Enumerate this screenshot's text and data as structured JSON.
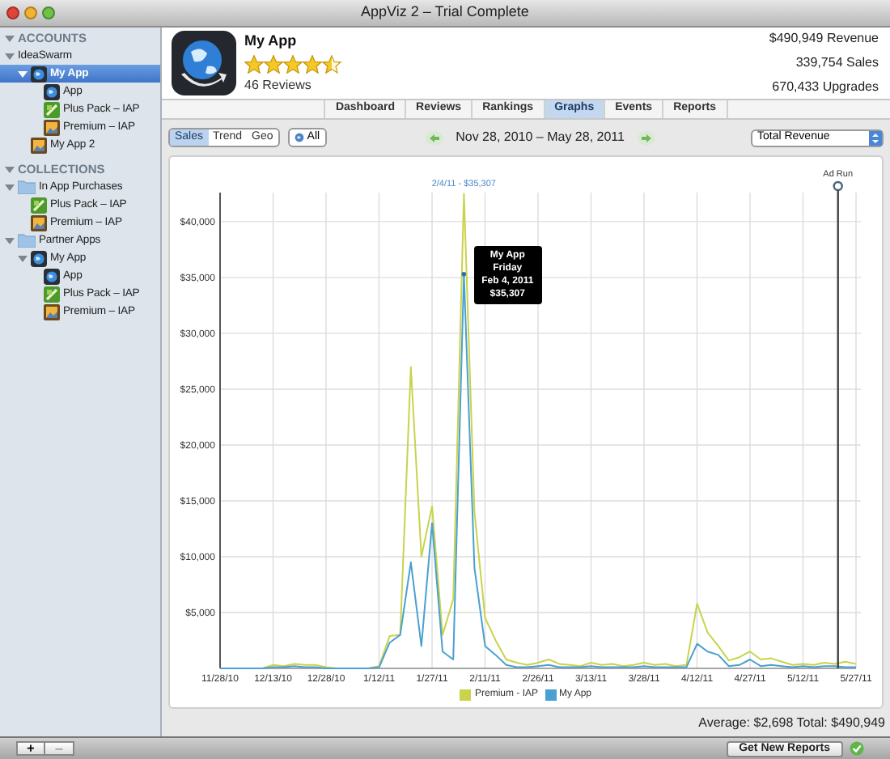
{
  "window": {
    "title": "AppViz 2 – Trial Complete"
  },
  "sidebar": {
    "sections": [
      {
        "title": "ACCOUNTS",
        "expanded": true,
        "items": [
          {
            "label": "IdeaSwarm",
            "selected": false,
            "expanded": true,
            "children": [
              {
                "label": "My App",
                "kind": "app",
                "selected": true,
                "expanded": true,
                "children": [
                  {
                    "label": "App",
                    "kind": "app",
                    "selected": false
                  },
                  {
                    "label": "Plus Pack – IAP",
                    "kind": "pack",
                    "selected": false
                  },
                  {
                    "label": "Premium – IAP",
                    "kind": "premium",
                    "selected": false
                  }
                ]
              },
              {
                "label": "My App 2",
                "kind": "premium",
                "selected": false
              }
            ]
          }
        ]
      },
      {
        "title": "COLLECTIONS",
        "expanded": true,
        "items": [
          {
            "label": "In App Purchases",
            "kind": "folder",
            "selected": false,
            "expanded": true,
            "children": [
              {
                "label": "Plus Pack – IAP",
                "kind": "pack",
                "selected": false
              },
              {
                "label": "Premium – IAP",
                "kind": "premium",
                "selected": false
              }
            ]
          },
          {
            "label": "Partner Apps",
            "kind": "folder",
            "selected": false,
            "expanded": true,
            "children": [
              {
                "label": "My App",
                "kind": "app",
                "selected": false,
                "expanded": true,
                "children": [
                  {
                    "label": "App",
                    "kind": "app",
                    "selected": false
                  },
                  {
                    "label": "Plus Pack – IAP",
                    "kind": "pack",
                    "selected": false
                  },
                  {
                    "label": "Premium – IAP",
                    "kind": "premium",
                    "selected": false
                  }
                ]
              }
            ]
          }
        ]
      }
    ]
  },
  "header": {
    "name": "My App",
    "stars": 4.5,
    "reviews": "46 Reviews",
    "stats": [
      "$490,949 Revenue",
      "339,754 Sales",
      "670,433 Upgrades"
    ]
  },
  "tabs": [
    {
      "label": "Dashboard",
      "selected": false
    },
    {
      "label": "Reviews",
      "selected": false
    },
    {
      "label": "Rankings",
      "selected": false
    },
    {
      "label": "Graphs",
      "selected": true
    },
    {
      "label": "Events",
      "selected": false
    },
    {
      "label": "Reports",
      "selected": false
    }
  ],
  "toolbar": {
    "modes": [
      {
        "label": "Sales",
        "selected": true
      },
      {
        "label": "Trend",
        "selected": false
      },
      {
        "label": "Geo",
        "selected": false
      }
    ],
    "filter": "All",
    "date_range": "Nov 28, 2010 – May 28, 2011",
    "metric": "Total Revenue"
  },
  "chart": {
    "tooltip": {
      "lines": [
        "My App",
        "Friday",
        "Feb 4, 2011",
        "$35,307"
      ]
    },
    "event_marker": {
      "label": "Ad Run"
    },
    "chart_data": {
      "type": "line",
      "categories": [
        "11/28/10",
        null,
        null,
        null,
        null,
        "12/13/10",
        null,
        null,
        null,
        null,
        "12/28/10",
        null,
        null,
        null,
        null,
        "1/12/11",
        null,
        null,
        null,
        null,
        "1/27/11",
        null,
        null,
        null,
        null,
        "2/11/11",
        null,
        null,
        null,
        null,
        "2/26/11",
        null,
        null,
        null,
        null,
        "3/13/11",
        null,
        null,
        null,
        null,
        "3/28/11",
        null,
        null,
        null,
        null,
        "4/12/11",
        null,
        null,
        null,
        null,
        "4/27/11",
        null,
        null,
        null,
        null,
        "5/12/11",
        null,
        null,
        null,
        null,
        "5/27/11"
      ],
      "series": [
        {
          "name": "Premium - IAP",
          "color": "#c9d34c",
          "values": [
            null,
            null,
            null,
            0,
            0,
            300,
            200,
            400,
            300,
            300,
            100,
            0,
            0,
            0,
            0,
            200,
            2900,
            3000,
            27000,
            10000,
            14500,
            3000,
            6200,
            42500,
            14000,
            4500,
            2500,
            800,
            500,
            300,
            500,
            800,
            400,
            300,
            200,
            500,
            300,
            400,
            200,
            300,
            500,
            300,
            400,
            200,
            300,
            5800,
            3200,
            2000,
            700,
            1000,
            1500,
            800,
            900,
            600,
            300,
            400,
            300,
            500,
            400,
            600,
            400
          ]
        },
        {
          "name": "My App",
          "color": "#4aa0d0",
          "values": [
            0,
            0,
            0,
            0,
            0,
            100,
            100,
            200,
            100,
            100,
            0,
            0,
            0,
            0,
            0,
            100,
            2300,
            3000,
            9500,
            2000,
            13000,
            1500,
            800,
            35300,
            9000,
            2000,
            1200,
            300,
            100,
            100,
            200,
            300,
            100,
            100,
            100,
            200,
            100,
            100,
            100,
            100,
            200,
            100,
            100,
            100,
            100,
            2200,
            1500,
            1200,
            200,
            300,
            800,
            200,
            300,
            200,
            100,
            200,
            100,
            200,
            200,
            100,
            100
          ]
        }
      ],
      "ylim": [
        0,
        42600
      ],
      "yticks": [
        {
          "value": 5000,
          "label": "$5,000"
        },
        {
          "value": 10000,
          "label": "$10,000"
        },
        {
          "value": 15000,
          "label": "$15,000"
        },
        {
          "value": 20000,
          "label": "$20,000"
        },
        {
          "value": 25000,
          "label": "$25,000"
        },
        {
          "value": 30000,
          "label": "$30,000"
        },
        {
          "value": 35000,
          "label": "$35,000"
        },
        {
          "value": 40000,
          "label": "$40,000"
        }
      ],
      "grid": true,
      "legend": true,
      "annotations": [
        "2/4/11 - $35,307"
      ]
    }
  },
  "summary": "Average: $2,698 Total: $490,949",
  "bottom_bar": {
    "add": "+",
    "remove": "–",
    "refresh": "Get New Reports"
  }
}
